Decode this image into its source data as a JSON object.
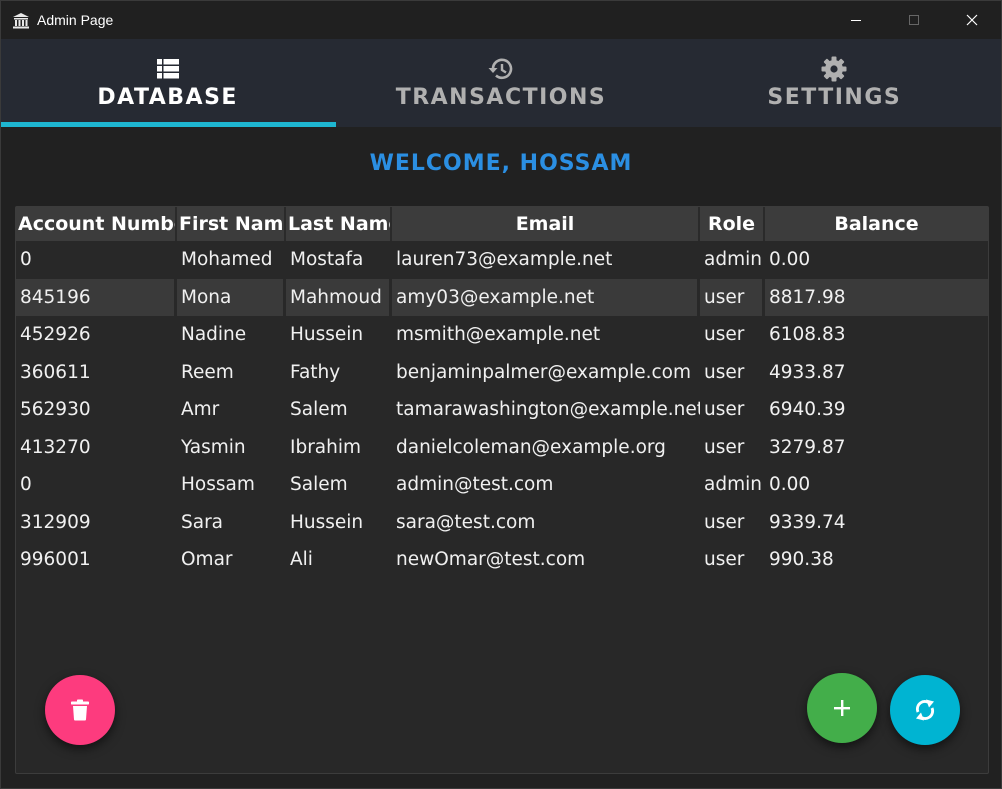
{
  "window": {
    "title": "Admin Page",
    "icon": "bank-icon",
    "controls": [
      "minimize-icon",
      "maximize-icon",
      "close-icon"
    ]
  },
  "tabs": [
    {
      "label": "DATABASE",
      "icon": "table-list-icon",
      "active": true
    },
    {
      "label": "TRANSACTIONS",
      "icon": "history-icon",
      "active": false
    },
    {
      "label": "SETTINGS",
      "icon": "gear-icon",
      "active": false
    }
  ],
  "welcome": "WELCOME, HOSSAM",
  "table": {
    "columns": [
      "Account Number",
      "First Name",
      "Last Name",
      "Email",
      "Role",
      "Balance"
    ],
    "rows": [
      [
        "0",
        "Mohamed",
        "Mostafa",
        "lauren73@example.net",
        "admin",
        "0.00"
      ],
      [
        "845196",
        "Mona",
        "Mahmoud",
        "amy03@example.net",
        "user",
        "8817.98"
      ],
      [
        "452926",
        "Nadine",
        "Hussein",
        "msmith@example.net",
        "user",
        "6108.83"
      ],
      [
        "360611",
        "Reem",
        "Fathy",
        "benjaminpalmer@example.com",
        "user",
        "4933.87"
      ],
      [
        "562930",
        "Amr",
        "Salem",
        "tamarawashington@example.net",
        "user",
        "6940.39"
      ],
      [
        "413270",
        "Yasmin",
        "Ibrahim",
        "danielcoleman@example.org",
        "user",
        "3279.87"
      ],
      [
        "0",
        "Hossam",
        "Salem",
        "admin@test.com",
        "admin",
        "0.00"
      ],
      [
        "312909",
        "Sara",
        "Hussein",
        "sara@test.com",
        "user",
        "9339.74"
      ],
      [
        "996001",
        "Omar",
        "Ali",
        "newOmar@test.com",
        "user",
        "990.38"
      ]
    ],
    "selected_row": 1
  },
  "actions": {
    "delete": {
      "icon": "trash-icon",
      "color": "#fd3b7e"
    },
    "add": {
      "icon": "plus-icon",
      "color": "#43ae4a"
    },
    "refresh": {
      "icon": "refresh-icon",
      "color": "#00b4d2"
    }
  },
  "colors": {
    "accent": "#1eb6d1",
    "welcome": "#2b8fe3",
    "tabbar": "#262a33"
  }
}
